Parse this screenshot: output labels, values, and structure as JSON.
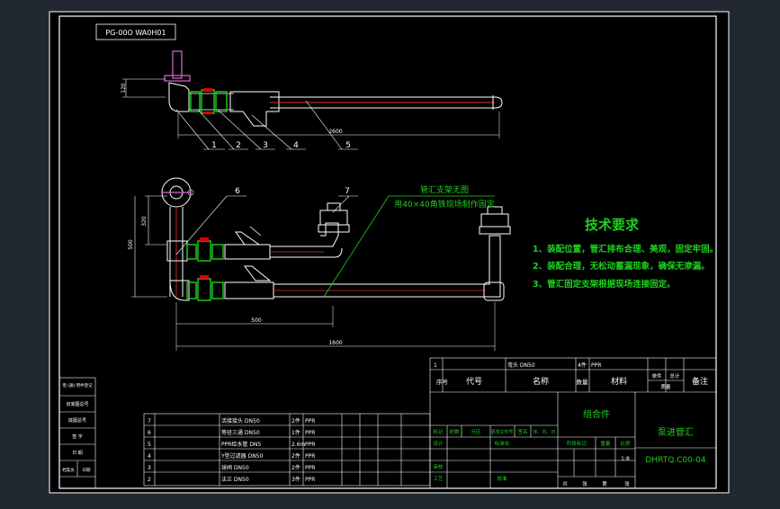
{
  "drawing": {
    "code_box": "PG-00O WA0H01",
    "dims": {
      "v_top": "120",
      "len_top": "2600",
      "v_320": "320",
      "v_500": "500",
      "len_500": "500",
      "len_1600": "1600"
    },
    "balloons": [
      "1",
      "2",
      "3",
      "4",
      "5",
      "6",
      "7"
    ],
    "note_line1": "管汇支架无图",
    "note_line2": "用40×40角铁现场制作固定"
  },
  "tech": {
    "title": "技术要求",
    "items": [
      "1、装配位置，管汇排布合理、美观，固定牢固。",
      "2、装配合理，无松动蓄漏现象，确保无渗漏。",
      "3、管汇固定支架根据现场连接固定。"
    ]
  },
  "bom": {
    "rows": [
      {
        "no": "7",
        "name": "活接接头 DN50",
        "qty": "2件",
        "mat": "PPR"
      },
      {
        "no": "6",
        "name": "等径三通 DN50",
        "qty": "1件",
        "mat": "PPR"
      },
      {
        "no": "5",
        "name": "PPR给水管 DN5",
        "qty": "2.6m",
        "mat": "PPR"
      },
      {
        "no": "4",
        "name": "Y型过滤器 DN50",
        "qty": "2件",
        "mat": "PPR"
      },
      {
        "no": "3",
        "name": "球阀 DN50",
        "qty": "2件",
        "mat": "PPR"
      },
      {
        "no": "2",
        "name": "法兰 DN50",
        "qty": "3件",
        "mat": "PPR"
      }
    ],
    "top_row": {
      "no": "1",
      "name": "弯头 DN50",
      "qty": "4件",
      "mat": "PPR"
    },
    "head": {
      "no": "序号",
      "code": "代号",
      "name": "名称",
      "qty": "数量",
      "mat": "材料",
      "unit": "单件",
      "total": "总计",
      "weight": "质量",
      "remark": "备注"
    }
  },
  "title_block": {
    "assembly": "组合件",
    "part_name": "泵进管汇",
    "drawing_no": "DHRTQ.C00-04",
    "scale": "1:8",
    "labels": {
      "mark": "标记",
      "count": "处数",
      "zone": "分区",
      "change_doc": "更改文件号",
      "sign": "签名",
      "date": "年、月、日",
      "design": "设计",
      "standard": "标准化",
      "check": "审核",
      "process": "工艺",
      "approve": "批准",
      "stage_mark": "阶段标记",
      "weight": "重量",
      "ratio": "比例",
      "sheets_total": "共",
      "sheets_of": "张",
      "sheet_no": "第",
      "sheet_unit": "张"
    }
  },
  "side_column": {
    "items": [
      "借 (通) 用件登记",
      "旧底图总号",
      "底图总号",
      "签 字",
      "日 期"
    ],
    "bottom": [
      "档案员",
      "日期"
    ]
  }
}
